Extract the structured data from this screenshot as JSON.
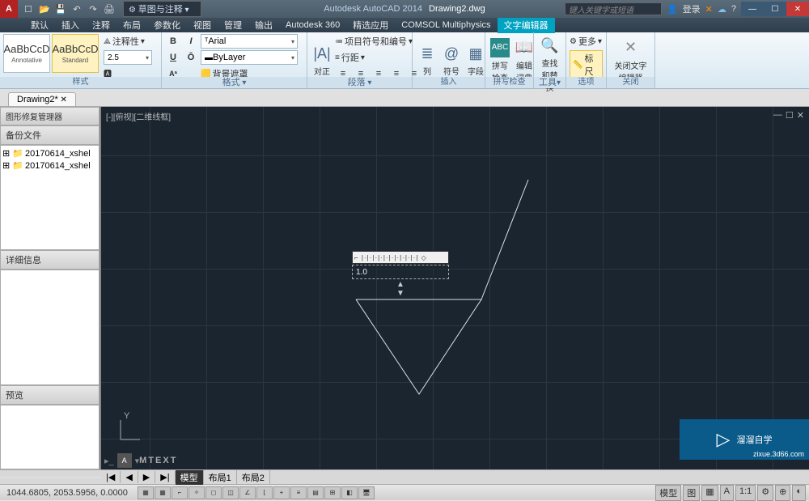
{
  "titlebar": {
    "logo": "A",
    "workspace": "草图与注释",
    "appname": "Autodesk AutoCAD 2014",
    "docname": "Drawing2.dwg",
    "search_placeholder": "键入关键字或短语",
    "login": "登录"
  },
  "menu": {
    "items": [
      "默认",
      "插入",
      "注释",
      "布局",
      "参数化",
      "视图",
      "管理",
      "输出",
      "Autodesk 360",
      "精选应用",
      "COMSOL Multiphysics",
      "文字编辑器"
    ],
    "active_index": 11
  },
  "ribbon": {
    "style": {
      "sample": "AaBbCcD",
      "annotative": "Annotative",
      "standard": "Standard",
      "label": "样式",
      "annostyle": "注释性",
      "height": "2.5"
    },
    "format": {
      "font": "Arial",
      "layer": "ByLayer",
      "bgmask": "背景遮罩",
      "label": "格式"
    },
    "paragraph": {
      "align": "对正",
      "bullets": "项目符号和编号",
      "linespacing": "行距",
      "label": "段落"
    },
    "insert": {
      "column": "列",
      "symbol": "符号",
      "field": "字段",
      "label": "插入"
    },
    "spell": {
      "check": "拼写检查",
      "dict": "编辑词典",
      "label": "拼写检查"
    },
    "tools": {
      "find": "查找和替换",
      "label": "工具"
    },
    "options": {
      "more": "更多",
      "ruler": "标尺",
      "label": "选项"
    },
    "close": {
      "btn": "关闭文字编辑器",
      "label": "关闭"
    }
  },
  "filetab": "Drawing2*",
  "panels": {
    "repair": "图形修复管理器",
    "backup": "备份文件",
    "files": [
      "20170614_xshel",
      "20170614_xshel"
    ],
    "details": "详细信息",
    "preview": "预览"
  },
  "canvas": {
    "viewlabel": "[-][俯视][二维线框]",
    "text_value": "1.0",
    "ucs_y": "Y",
    "cmd_prefix": "A",
    "cmd": "MTEXT"
  },
  "watermark": {
    "main": "溜溜自学",
    "sub": "zixue.3d66.com"
  },
  "modeltabs": {
    "items": [
      "模型",
      "布局1",
      "布局2"
    ],
    "active": 0,
    "nav": [
      "|◀",
      "◀",
      "▶",
      "▶|"
    ]
  },
  "status": {
    "coords": "1044.6805, 2053.5956, 0.0000",
    "right": [
      "模型",
      "图",
      "▦",
      "A",
      "1:1",
      "⚙",
      "⊕",
      "◐"
    ]
  }
}
